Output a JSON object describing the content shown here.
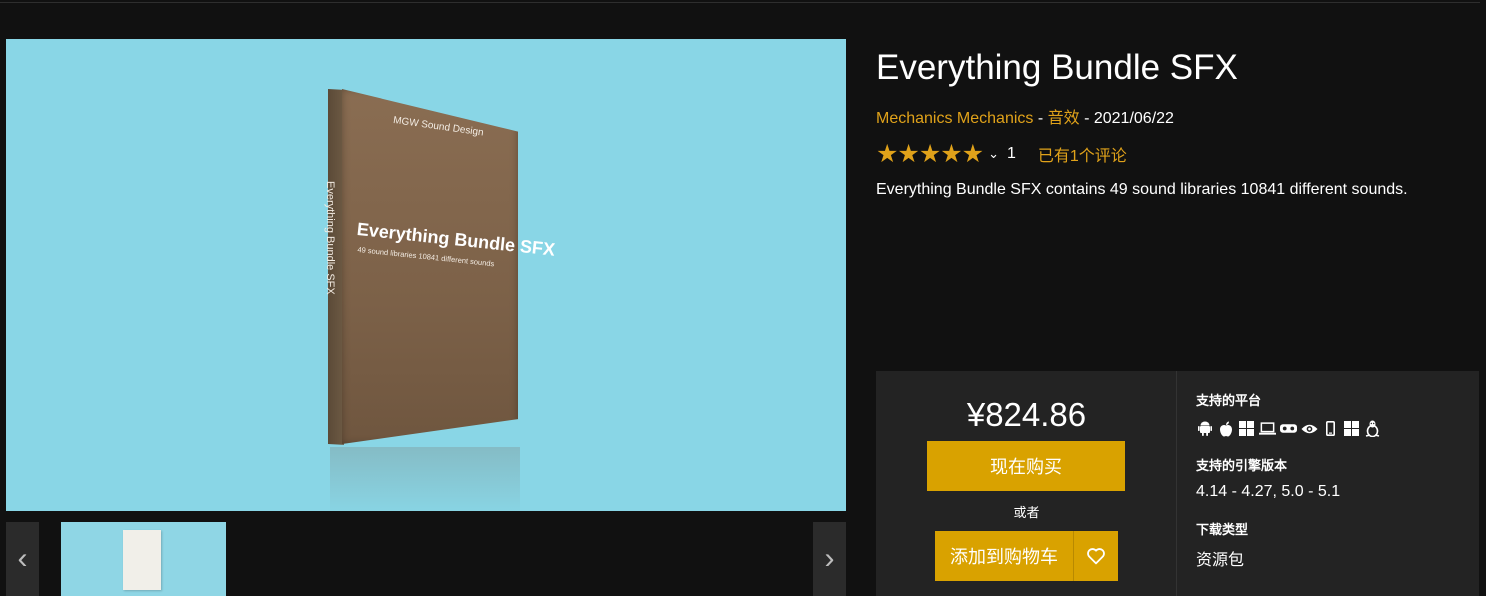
{
  "product": {
    "title": "Everything Bundle SFX",
    "author": "Mechanics Mechanics",
    "separator1": " - ",
    "category": "音效",
    "separator2": " - ",
    "date": "2021/06/22",
    "rating_count": "1",
    "reviews_link": "已有1个评论",
    "stars": "★★★★★",
    "description": "Everything Bundle SFX contains 49 sound libraries 10841 different sounds."
  },
  "hero_image": {
    "box_brand": "MGW Sound Design",
    "box_title": "Everything Bundle SFX",
    "box_subtitle": "49 sound libraries 10841 different sounds",
    "box_spine": "Everything Bundle SFX"
  },
  "purchase": {
    "price": "¥824.86",
    "buy_now": "现在购买",
    "or": "或者",
    "add_to_cart": "添加到购物车"
  },
  "specs": {
    "platforms_label": "支持的平台",
    "platform_icons": [
      "android-icon",
      "apple-icon",
      "windows-icon",
      "laptop-icon",
      "vr-headset-icon",
      "eye-icon",
      "phone-icon",
      "windows-icon",
      "linux-icon"
    ],
    "engine_label": "支持的引擎版本",
    "engine_versions": "4.14 - 4.27, 5.0 - 5.1",
    "download_label": "下载类型",
    "download_type": "资源包"
  },
  "colors": {
    "accent": "#d9a200",
    "link": "#e0a21a",
    "background": "#111111",
    "panel": "#232323",
    "hero_bg": "#89d6e6"
  }
}
